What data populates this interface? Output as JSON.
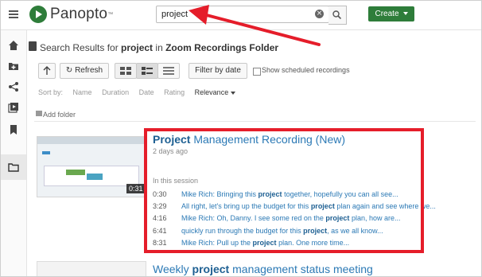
{
  "header": {
    "logo_text": "Panopto",
    "search_value": "project",
    "create_label": "Create"
  },
  "results": {
    "prefix": "Search Results for ",
    "query": "project",
    "mid": " in ",
    "folder": "Zoom Recordings Folder"
  },
  "toolbar": {
    "refresh_label": "Refresh",
    "filter_label": "Filter by date",
    "show_scheduled_label": "Show scheduled recordings"
  },
  "sort": {
    "label": "Sort by:",
    "options": [
      "Name",
      "Duration",
      "Date",
      "Rating",
      "Relevance"
    ]
  },
  "add_folder_label": "Add folder",
  "result1": {
    "title_highlight": "Project",
    "title_rest": " Management Recording (New)",
    "age": "2 days ago",
    "duration": "0:31",
    "session_label": "In this session",
    "segments": [
      {
        "time": "0:30",
        "pre": "Mike Rich: Bringing this ",
        "hl": "project",
        "post": " together, hopefully you can all see..."
      },
      {
        "time": "3:29",
        "pre": "All right, let's bring up the budget for this ",
        "hl": "project",
        "post": " plan again and see where we..."
      },
      {
        "time": "4:16",
        "pre": "Mike Rich: Oh, Danny. I see some red on the ",
        "hl": "project",
        "post": " plan, how are..."
      },
      {
        "time": "6:41",
        "pre": "quickly run through the budget for this ",
        "hl": "project",
        "post": ", as we all know..."
      },
      {
        "time": "8:31",
        "pre": "Mike Rich: Pull up the ",
        "hl": "project",
        "post": " plan. One more time..."
      }
    ]
  },
  "result2": {
    "pre": "Weekly ",
    "hl": "project",
    "post": " management status meeting"
  },
  "colors": {
    "brand_green": "#2e7d3a",
    "link_blue": "#2b79b5",
    "highlight_red": "#e51d2a"
  }
}
